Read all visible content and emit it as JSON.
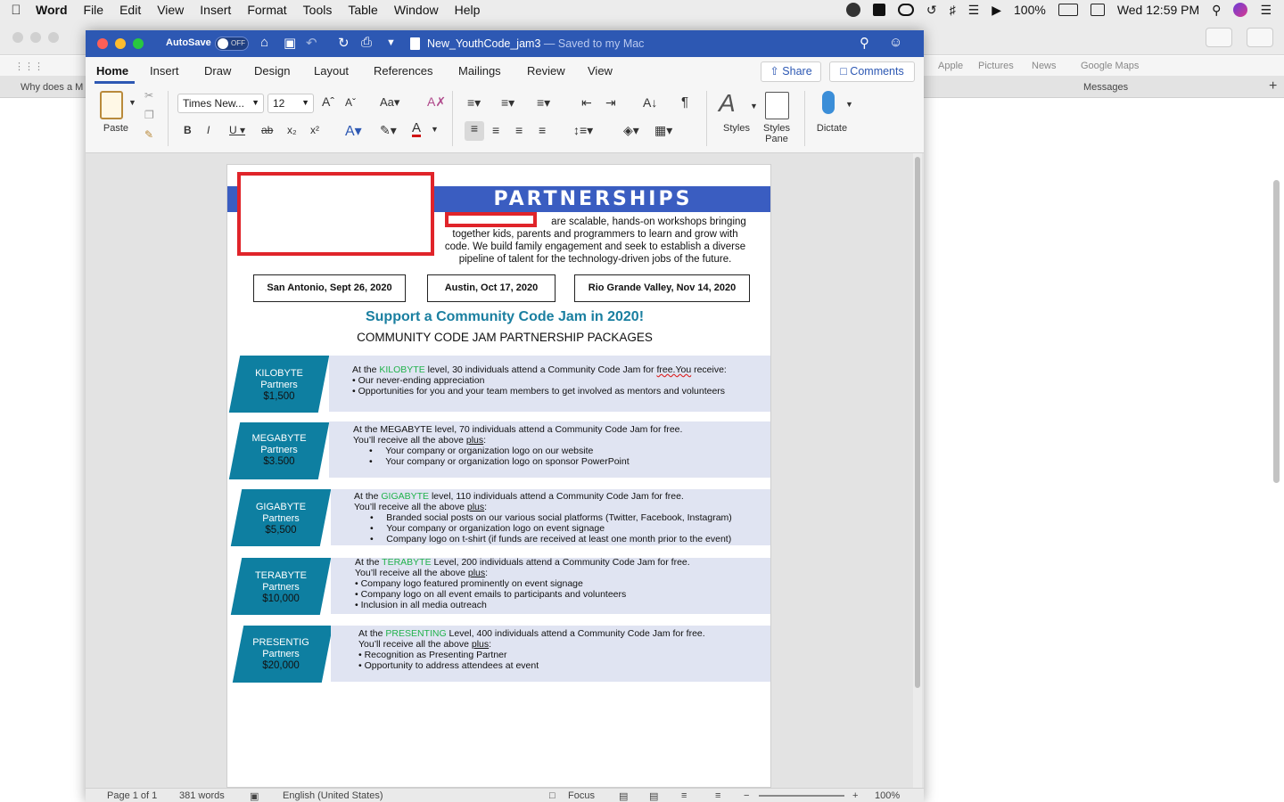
{
  "menubar": {
    "app": "Word",
    "items": [
      "File",
      "Edit",
      "View",
      "Insert",
      "Format",
      "Tools",
      "Table",
      "Window",
      "Help"
    ],
    "battery": "100%",
    "clock": "Wed 12:59 PM"
  },
  "background": {
    "favorites": [
      "Apple",
      "Pictures",
      "News",
      "Google Maps"
    ],
    "tab1": "Why does a M",
    "tab2": "Messages"
  },
  "titlebar": {
    "autosave": "AutoSave",
    "toggle": "OFF",
    "doc_title": "New_YouthCode_jam3",
    "saved_status": "— Saved to my Mac"
  },
  "ribbon": {
    "tabs": [
      "Home",
      "Insert",
      "Draw",
      "Design",
      "Layout",
      "References",
      "Mailings",
      "Review",
      "View"
    ],
    "share": "Share",
    "comments": "Comments",
    "paste": "Paste",
    "font_name": "Times New...",
    "font_size": "12",
    "styles": "Styles",
    "styles_pane_1": "Styles",
    "styles_pane_2": "Pane",
    "dictate": "Dictate"
  },
  "document": {
    "banner_title": "PARTNERSHIPS",
    "intro": [
      "are scalable, hands-on workshops bringing",
      "together kids, parents and programmers to learn and grow with",
      "code. We build family engagement and seek to establish a diverse",
      "pipeline of talent for the technology-driven jobs of the future."
    ],
    "cities": [
      "San Antonio, Sept 26, 2020",
      "Austin, Oct 17, 2020",
      "Rio Grande Valley, Nov 14, 2020"
    ],
    "support_heading": "Support a Community Code Jam in 2020!",
    "packages_heading": "COMMUNITY CODE JAM PARTNERSHIP PACKAGES",
    "packages": [
      {
        "name": "KILOBYTE",
        "partners": "Partners",
        "price": "$1,500",
        "line1_a": "At the ",
        "level": "KILOBYTE",
        "line1_b": " level, 30 individuals attend a Community Code Jam for ",
        "free_you": "free.You",
        "line1_c": " receive:",
        "bullets": [
          "Our never-ending appreciation",
          "Opportunities for you and your team members to get involved as mentors and volunteers"
        ]
      },
      {
        "name": "MEGABYTE",
        "partners": "Partners",
        "price": "$3,500",
        "line1": "At the MEGABYTE level, 70 individuals attend a Community Code Jam for free.",
        "line2_a": "You’ll receive all the above ",
        "plus": "plus",
        "bullets": [
          "Your company or organization logo on our website",
          "Your company or organization logo on sponsor PowerPoint"
        ]
      },
      {
        "name": "GIGABYTE",
        "partners": "Partners",
        "price": "$5,500",
        "line1_a": "At the ",
        "level": "GIGABYTE",
        "line1_b": " level, 110 individuals attend a Community Code Jam for free.",
        "line2_a": "You’ll receive all the above ",
        "plus": "plus",
        "bullets": [
          "Branded social posts on our various social platforms (Twitter, Facebook, Instagram)",
          "Your company or organization logo on event signage",
          "Company logo on t-shirt (if funds are received at least one month prior to the event)"
        ]
      },
      {
        "name": "TERABYTE",
        "partners": "Partners",
        "price": "$10,000",
        "line1_a": "At the ",
        "level": "TERABYTE",
        "line1_b": " Level, 200 individuals attend a Community Code Jam for free.",
        "line2_a": "You’ll receive all the above ",
        "plus": "plus",
        "bullets": [
          "Company logo featured prominently on event signage",
          "Company logo on all event emails to participants and volunteers",
          "Inclusion in all media outreach"
        ]
      },
      {
        "name": "PRESENTIG",
        "partners": "Partners",
        "price": "$20,000",
        "line1_a": "At the ",
        "level": "PRESENTING",
        "line1_b": " Level, 400 individuals attend a Community Code Jam for free.",
        "line2_a": "You’ll receive all the above ",
        "plus": "plus",
        "bullets": [
          "Recognition as Presenting Partner",
          "Opportunity to address attendees at event"
        ]
      }
    ]
  },
  "statusbar": {
    "page": "Page 1 of 1",
    "words": "381 words",
    "language": "English (United States)",
    "focus": "Focus",
    "zoom": "100%"
  },
  "colors": {
    "title_blue": "#2d58b3",
    "banner_blue": "#3a5dc1",
    "teal": "#0e7fa1",
    "level_green": "#22b24c",
    "redact_red": "#e0242a"
  }
}
